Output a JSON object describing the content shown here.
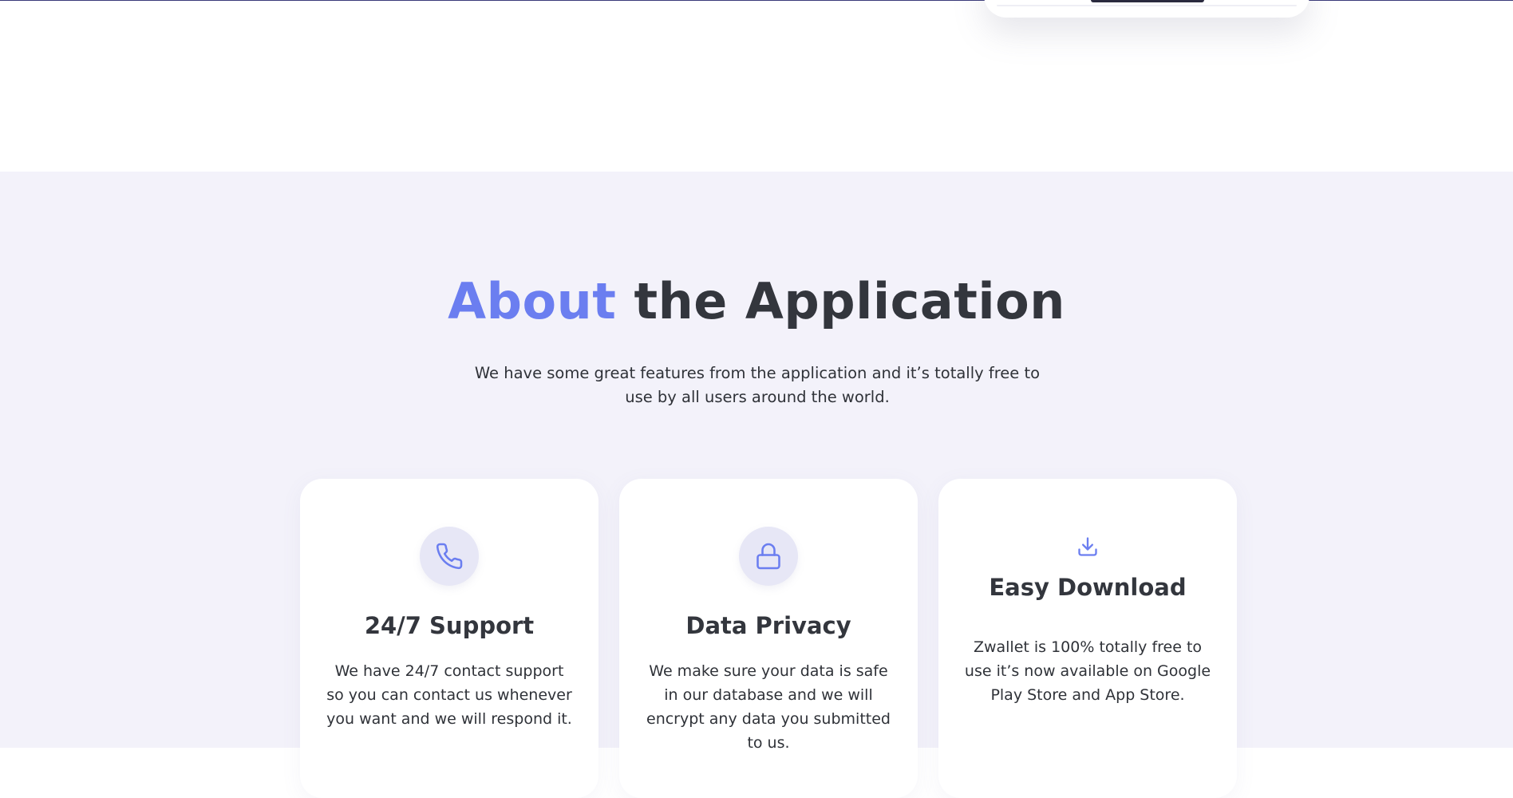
{
  "colors": {
    "accent": "#6b7ef0",
    "heading": "#33363d",
    "section_background": "#f3f2fa",
    "icon_circle": "#e7e7f6"
  },
  "about": {
    "title_accent": "About",
    "title_rest": " the Application",
    "subtitle": "We have some great features from the application and it’s totally free to use by all users around the world."
  },
  "features": [
    {
      "icon": "phone-icon",
      "title": "24/7 Support",
      "text": "We have 24/7 contact support so you can contact us whenever you want and we will respond it."
    },
    {
      "icon": "lock-icon",
      "title": "Data Privacy",
      "text": "We make sure your data is safe in our database and we will encrypt any data you submitted to us."
    },
    {
      "icon": "download-icon",
      "title": "Easy Download",
      "text": "Zwallet is 100% totally free to use it’s now available on Google Play Store and App Store."
    }
  ]
}
